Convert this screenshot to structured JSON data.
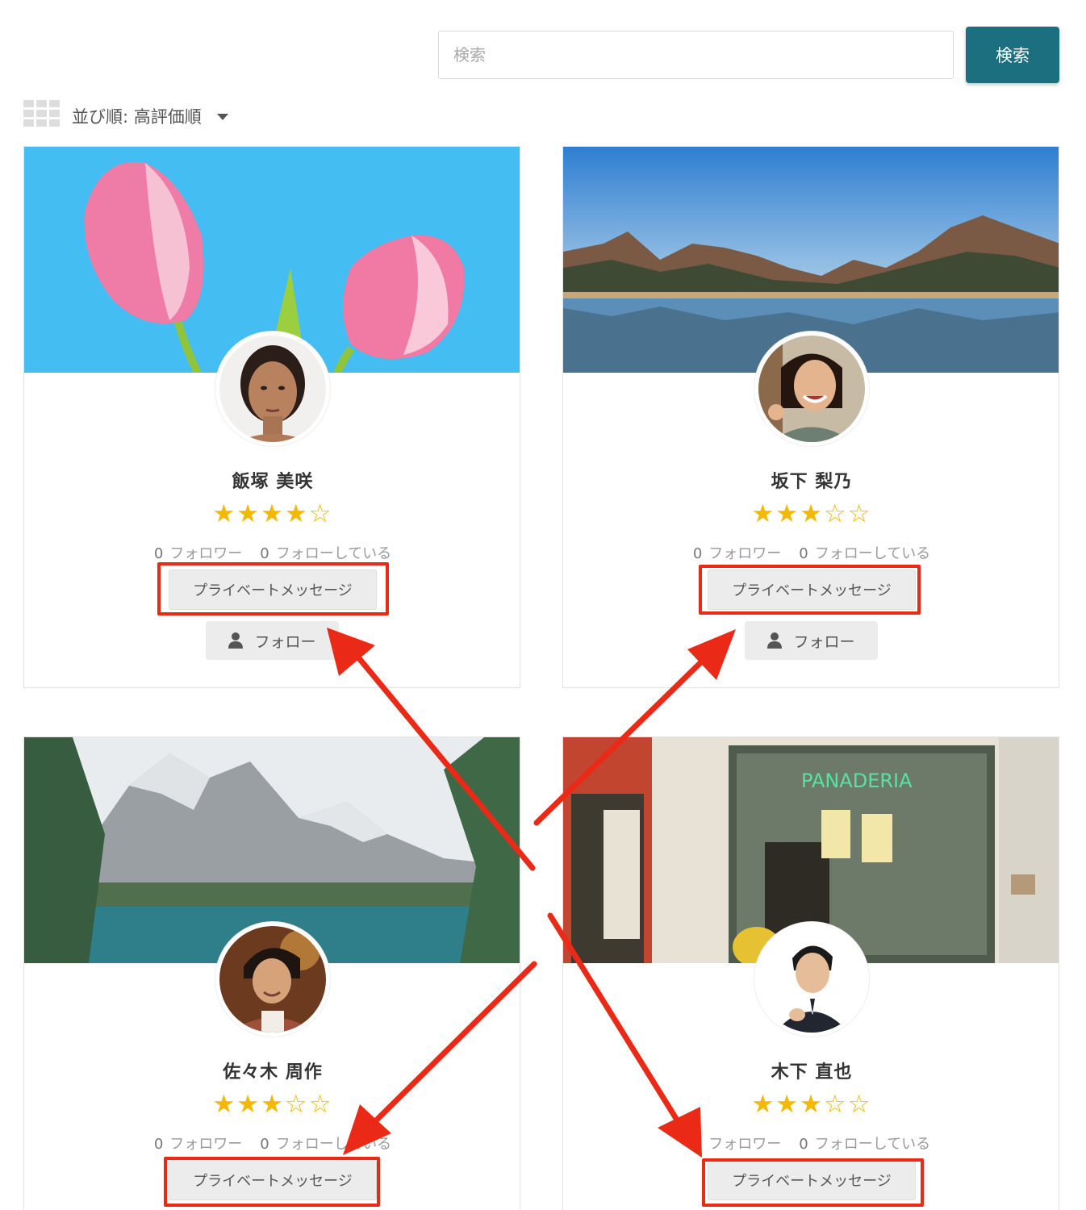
{
  "search": {
    "placeholder": "検索",
    "button_label": "検索"
  },
  "sort": {
    "label": "並び順: 高評価順"
  },
  "profiles": [
    {
      "name": "飯塚 美咲",
      "rating": 4,
      "max_rating": 5,
      "followers": "0",
      "followers_label": "フォロワー",
      "following": "0",
      "following_label": "フォローしている",
      "message_label": "プライベートメッセージ",
      "follow_label": "フォロー"
    },
    {
      "name": "坂下 梨乃",
      "rating": 3,
      "max_rating": 5,
      "followers": "0",
      "followers_label": "フォロワー",
      "following": "0",
      "following_label": "フォローしている",
      "message_label": "プライベートメッセージ",
      "follow_label": "フォロー"
    },
    {
      "name": "佐々木 周作",
      "rating": 3,
      "max_rating": 5,
      "followers": "0",
      "followers_label": "フォロワー",
      "following": "0",
      "following_label": "フォローしている",
      "message_label": "プライベートメッセージ"
    },
    {
      "name": "木下 直也",
      "rating": 3,
      "max_rating": 5,
      "followers": "0",
      "followers_label": "フォロワー",
      "following": "0",
      "following_label": "フォローしている",
      "message_label": "プライベートメッセージ"
    }
  ],
  "cover_sign_text": "PANADERIA",
  "colors": {
    "accent": "#1b6f7e",
    "star": "#f3b800",
    "highlight": "#ea2a16",
    "button_bg": "#ececec"
  },
  "icons": [
    "grid-view-icon",
    "caret-down-icon",
    "user-icon",
    "star-icon"
  ]
}
